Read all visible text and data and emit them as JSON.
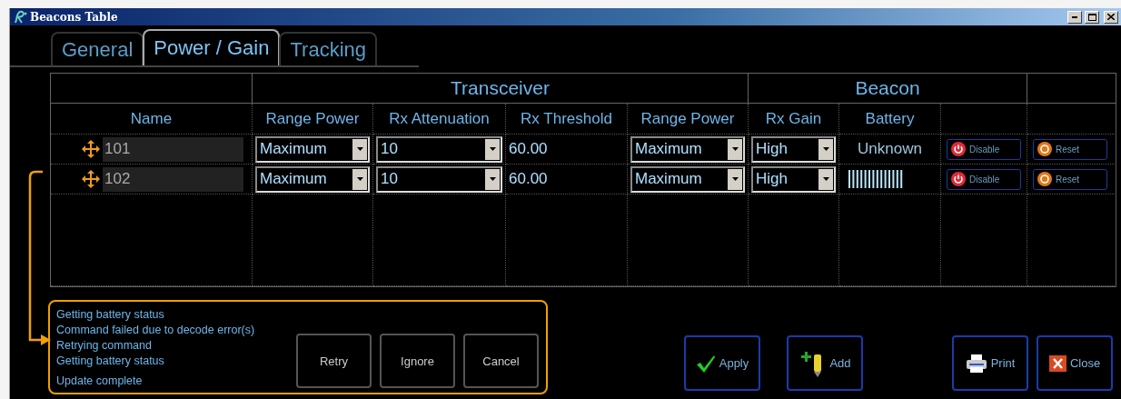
{
  "window": {
    "title": "Beacons Table"
  },
  "tabs": [
    {
      "label": "General",
      "selected": false
    },
    {
      "label": "Power / Gain",
      "selected": true
    },
    {
      "label": "Tracking",
      "selected": false
    }
  ],
  "table": {
    "groups": [
      {
        "label": "Transceiver"
      },
      {
        "label": "Beacon"
      }
    ],
    "columns": [
      "Name",
      "Range Power",
      "Rx Attenuation",
      "Rx Threshold",
      "Range Power",
      "Rx Gain",
      "Battery"
    ],
    "rows": [
      {
        "name": "101",
        "tx_range_power": "Maximum",
        "rx_attenuation": "10",
        "rx_threshold": "60.00",
        "beacon_range_power": "Maximum",
        "rx_gain": "High",
        "battery": {
          "kind": "text",
          "text": "Unknown"
        },
        "disable": "Disable",
        "reset": "Reset"
      },
      {
        "name": "102",
        "tx_range_power": "Maximum",
        "rx_attenuation": "10",
        "rx_threshold": "60.00",
        "beacon_range_power": "Maximum",
        "rx_gain": "High",
        "battery": {
          "kind": "meter"
        },
        "disable": "Disable",
        "reset": "Reset"
      }
    ]
  },
  "status": {
    "messages": [
      "Getting battery status",
      "Command failed due to decode error(s)",
      "Retrying command",
      "Getting battery status"
    ],
    "summary": "Update complete",
    "buttons": [
      "Retry",
      "Ignore",
      "Cancel"
    ]
  },
  "actions": [
    {
      "kind": "apply",
      "label": "Apply"
    },
    {
      "kind": "add",
      "label": "Add"
    },
    {
      "kind": "print",
      "label": "Print"
    },
    {
      "kind": "close",
      "label": "Close"
    }
  ]
}
